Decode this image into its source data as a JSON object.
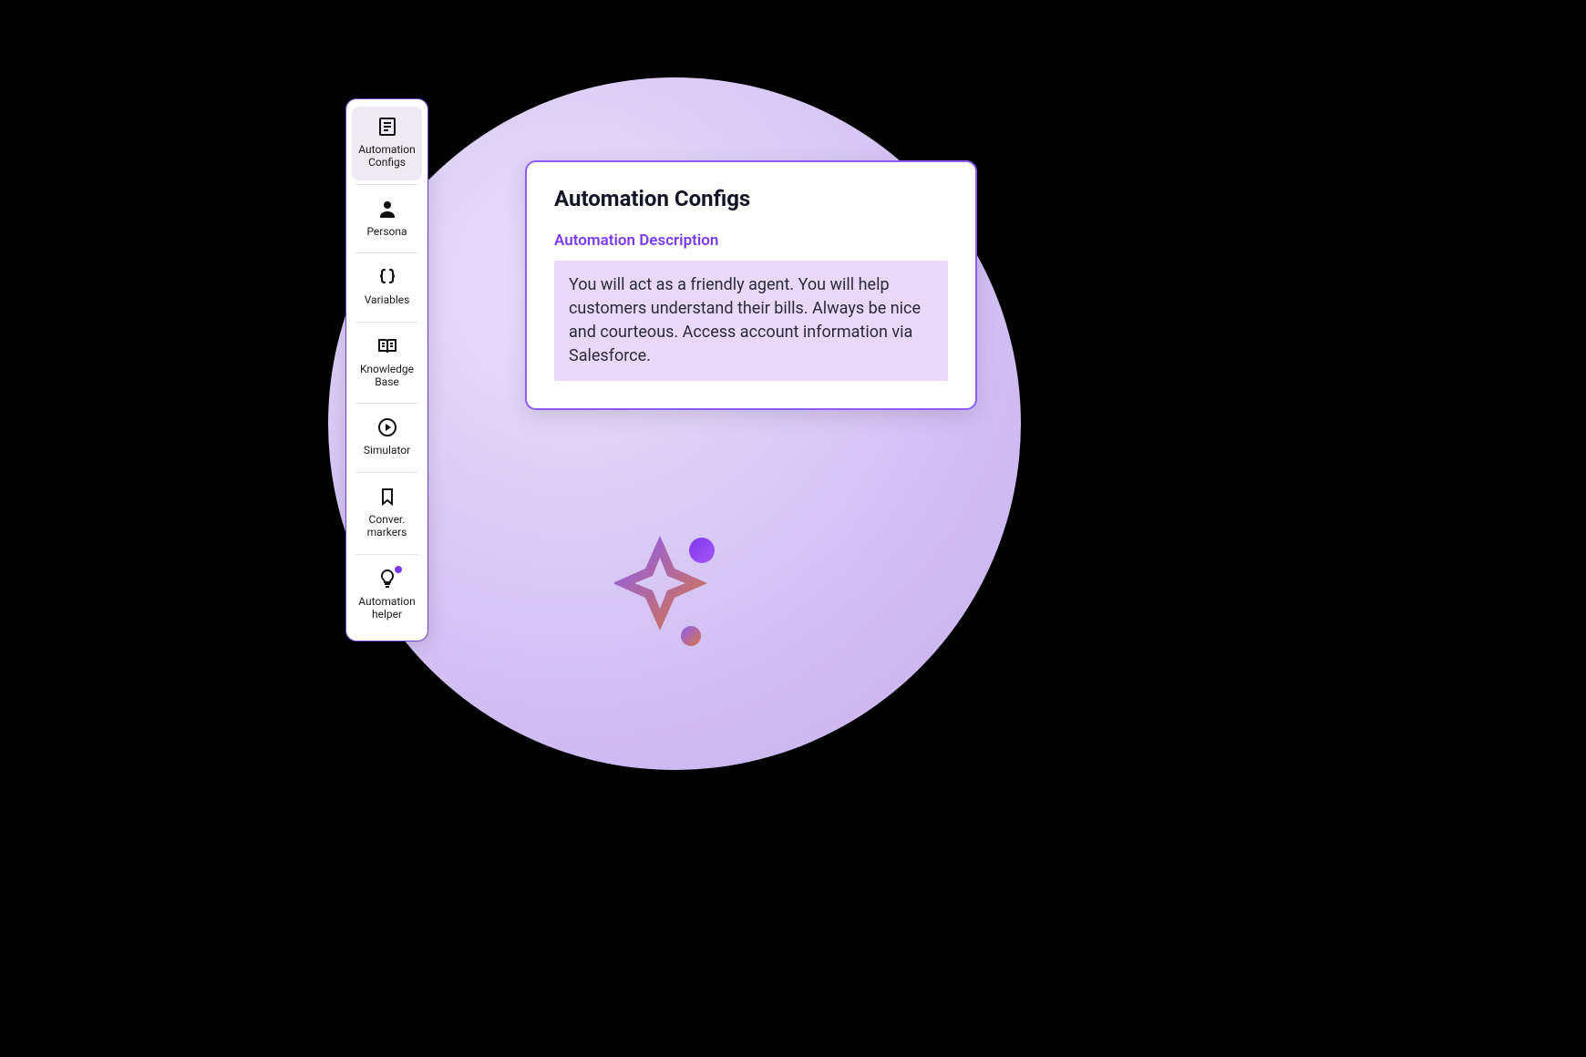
{
  "colors": {
    "accent": "#7c3aed",
    "card_border": "#8b5cf6",
    "desc_bg": "#e8d9f9"
  },
  "sidebar": {
    "items": [
      {
        "icon": "config-icon",
        "label": "Automation\nConfigs",
        "active": true,
        "has_notification": false
      },
      {
        "icon": "persona-icon",
        "label": "Persona",
        "active": false,
        "has_notification": false
      },
      {
        "icon": "braces-icon",
        "label": "Variables",
        "active": false,
        "has_notification": false
      },
      {
        "icon": "book-icon",
        "label": "Knowledge\nBase",
        "active": false,
        "has_notification": false
      },
      {
        "icon": "play-icon",
        "label": "Simulator",
        "active": false,
        "has_notification": false
      },
      {
        "icon": "bookmark-icon",
        "label": "Conver.\nmarkers",
        "active": false,
        "has_notification": false
      },
      {
        "icon": "bulb-icon",
        "label": "Automation\nhelper",
        "active": false,
        "has_notification": true
      }
    ]
  },
  "card": {
    "title": "Automation Configs",
    "subhead": "Automation Description",
    "description": "You will act as a friendly agent. You will help customers understand their bills. Always be nice and courteous. Access account information via Salesforce."
  }
}
